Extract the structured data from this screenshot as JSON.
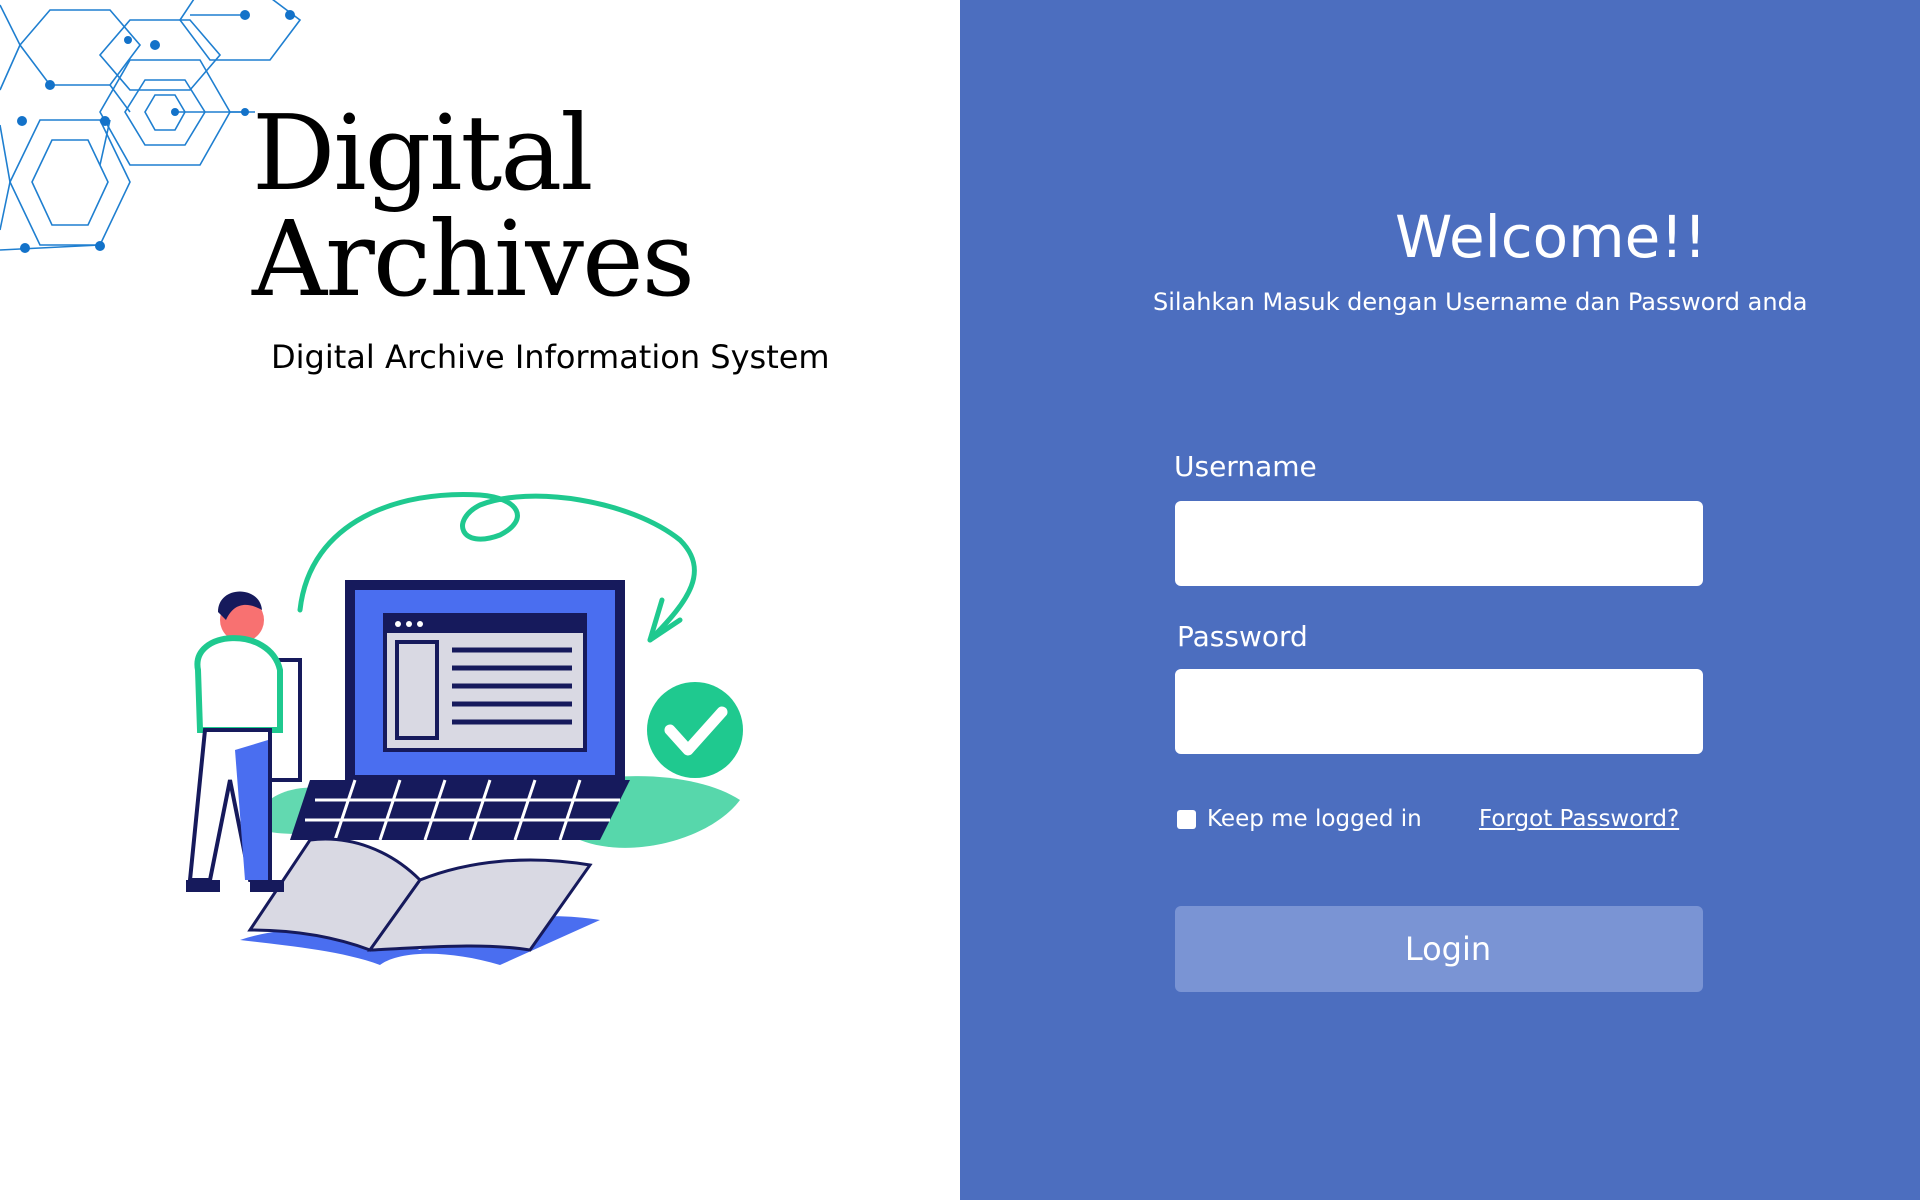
{
  "brand": {
    "title_line1": "Digital",
    "title_line2": "Archives",
    "subtitle": "Digital Archive Information System"
  },
  "login": {
    "welcome": "Welcome!!",
    "instructions": "Silahkan Masuk dengan Username dan Password anda",
    "username_label": "Username",
    "username_value": "",
    "password_label": "Password",
    "password_value": "",
    "remember_label": "Keep me logged in",
    "remember_checked": false,
    "forgot_label": "Forgot Password?",
    "login_label": "Login"
  },
  "colors": {
    "panel_bg": "#4c6ebf",
    "button_bg": "#7a94d4",
    "hex_line": "#1f7fd0",
    "accent_green": "#1fc98f",
    "navy": "#161a5c",
    "laptop_blue": "#4a6ef0"
  },
  "icons": {
    "checkmark": "check-circle-icon",
    "hexagon_pattern": "hexagon-network-icon"
  }
}
